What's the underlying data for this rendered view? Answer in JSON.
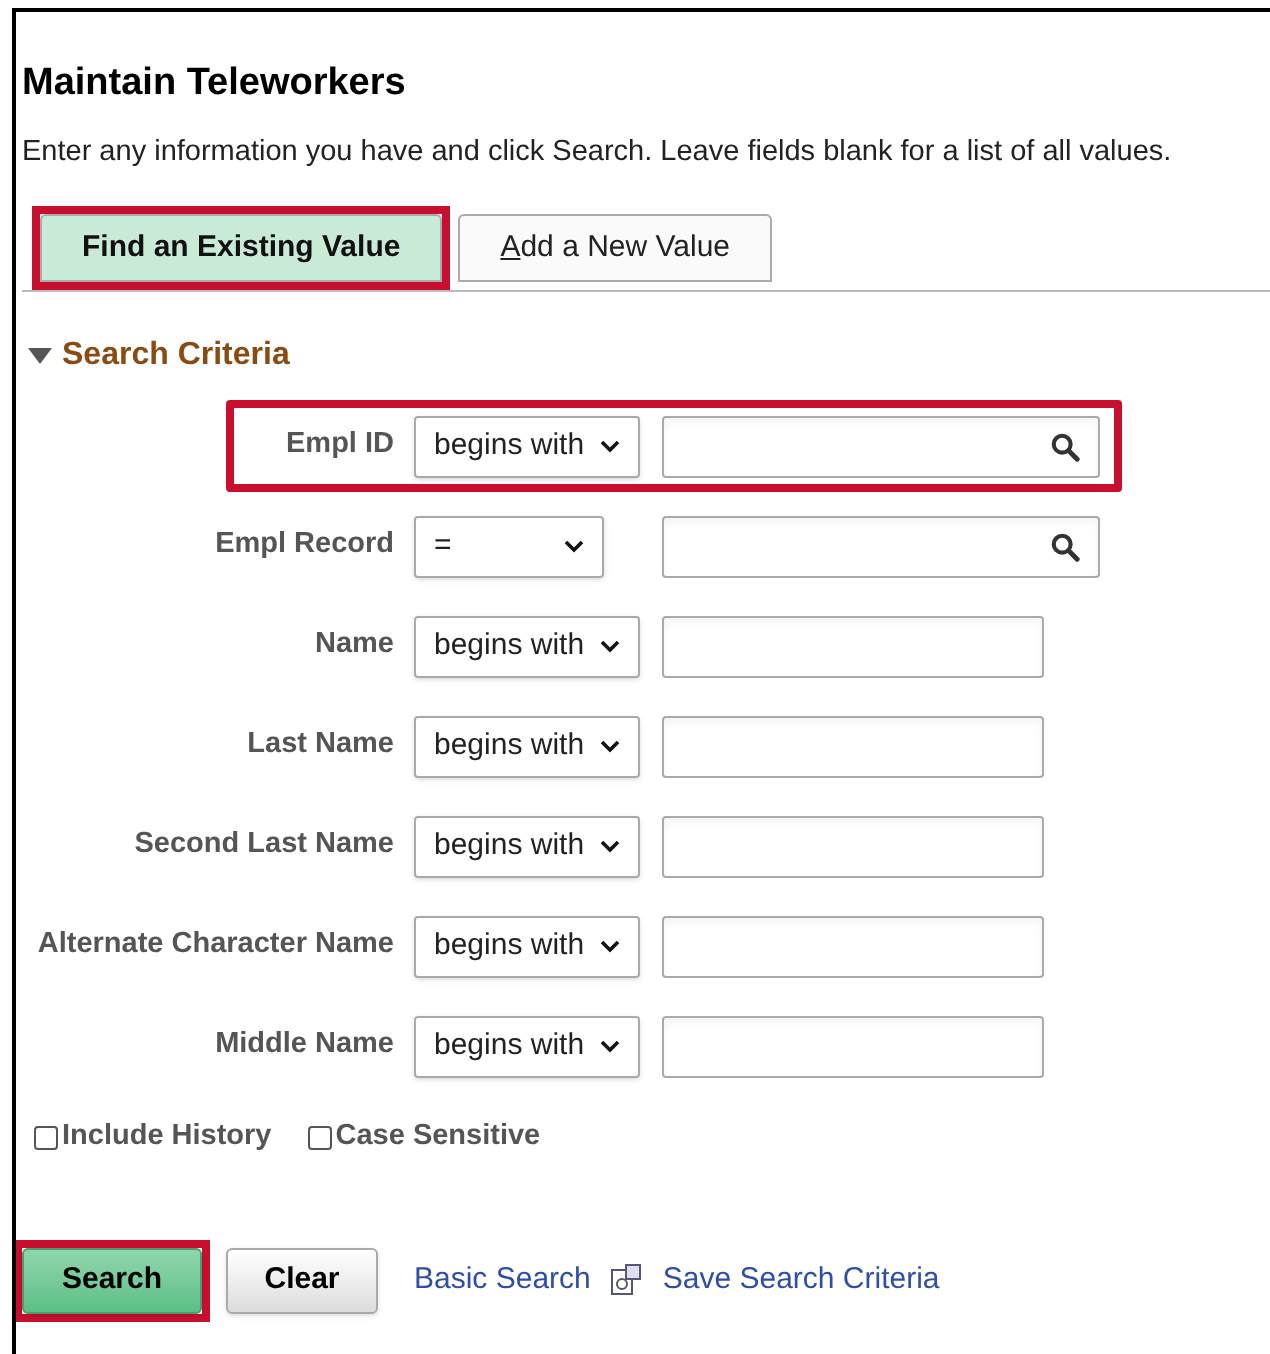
{
  "title": "Maintain Teleworkers",
  "instructions": "Enter any information you have and click Search. Leave fields blank for a list of all values.",
  "tabs": [
    {
      "label": "Find an Existing Value",
      "selected": true,
      "highlighted": true
    },
    {
      "label": "Add a New Value",
      "selected": false,
      "highlighted": false
    }
  ],
  "section": {
    "title": "Search Criteria",
    "expanded": true
  },
  "fields": [
    {
      "label": "Empl ID",
      "operator": "begins with",
      "lookup": true,
      "highlighted": true
    },
    {
      "label": "Empl Record",
      "operator": "=",
      "lookup": true,
      "highlighted": false
    },
    {
      "label": "Name",
      "operator": "begins with",
      "lookup": false,
      "highlighted": false
    },
    {
      "label": "Last Name",
      "operator": "begins with",
      "lookup": false,
      "highlighted": false
    },
    {
      "label": "Second Last Name",
      "operator": "begins with",
      "lookup": false,
      "highlighted": false
    },
    {
      "label": "Alternate Character Name",
      "operator": "begins with",
      "lookup": false,
      "highlighted": false
    },
    {
      "label": "Middle Name",
      "operator": "begins with",
      "lookup": false,
      "highlighted": false
    }
  ],
  "checkboxes": [
    {
      "label": "Include History",
      "checked": false
    },
    {
      "label": "Case Sensitive",
      "checked": false
    }
  ],
  "buttons": [
    {
      "label": "Search",
      "kind": "primary",
      "highlighted": true
    },
    {
      "label": "Clear",
      "kind": "secondary",
      "highlighted": false
    }
  ],
  "links": [
    {
      "label": "Basic Search",
      "icon": false
    },
    {
      "label": "Save Search Criteria",
      "icon": true
    }
  ]
}
